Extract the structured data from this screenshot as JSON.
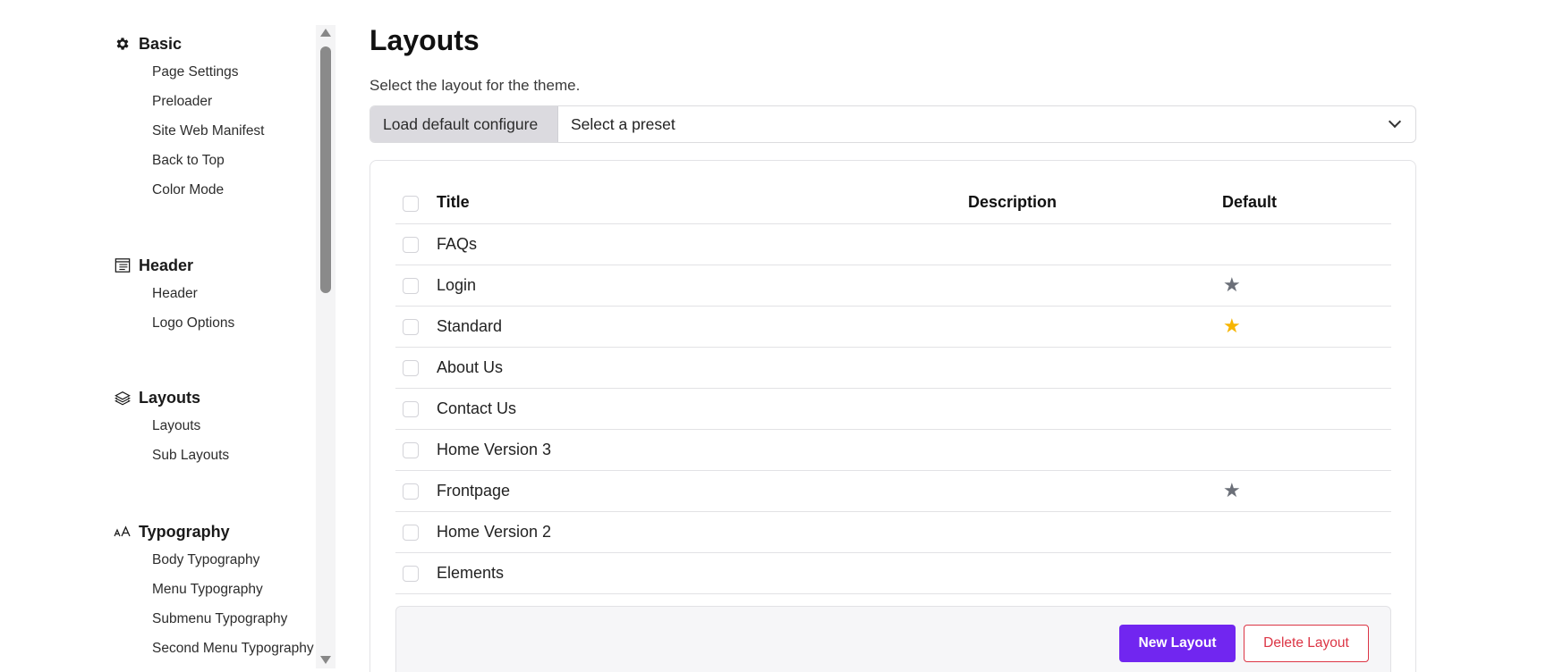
{
  "sidebar": {
    "sections": [
      {
        "title": "Basic",
        "icon": "gear-icon",
        "items": [
          "Page Settings",
          "Preloader",
          "Site Web Manifest",
          "Back to Top",
          "Color Mode"
        ]
      },
      {
        "title": "Header",
        "icon": "header-icon",
        "items": [
          "Header",
          "Logo Options"
        ]
      },
      {
        "title": "Layouts",
        "icon": "layers-icon",
        "items": [
          "Layouts",
          "Sub Layouts"
        ]
      },
      {
        "title": "Typography",
        "icon": "typography-icon",
        "items": [
          "Body Typography",
          "Menu Typography",
          "Submenu Typography",
          "Second Menu Typography"
        ]
      }
    ]
  },
  "main": {
    "title": "Layouts",
    "description": "Select the layout for the theme.",
    "preset": {
      "label": "Load default configure",
      "placeholder": "Select a preset"
    },
    "table": {
      "headers": {
        "title": "Title",
        "description": "Description",
        "default": "Default"
      },
      "rows": [
        {
          "title": "FAQs",
          "description": "",
          "default": "none"
        },
        {
          "title": "Login",
          "description": "",
          "default": "grey"
        },
        {
          "title": "Standard",
          "description": "",
          "default": "gold"
        },
        {
          "title": "About Us",
          "description": "",
          "default": "none"
        },
        {
          "title": "Contact Us",
          "description": "",
          "default": "none"
        },
        {
          "title": "Home Version 3",
          "description": "",
          "default": "none"
        },
        {
          "title": "Frontpage",
          "description": "",
          "default": "grey"
        },
        {
          "title": "Home Version 2",
          "description": "",
          "default": "none"
        },
        {
          "title": "Elements",
          "description": "",
          "default": "none"
        }
      ]
    },
    "buttons": {
      "new": "New Layout",
      "delete": "Delete Layout"
    }
  },
  "colors": {
    "primary": "#7126f0",
    "danger": "#dc3545",
    "star_default": "#f7b500",
    "star_inactive": "#6b6f78"
  }
}
